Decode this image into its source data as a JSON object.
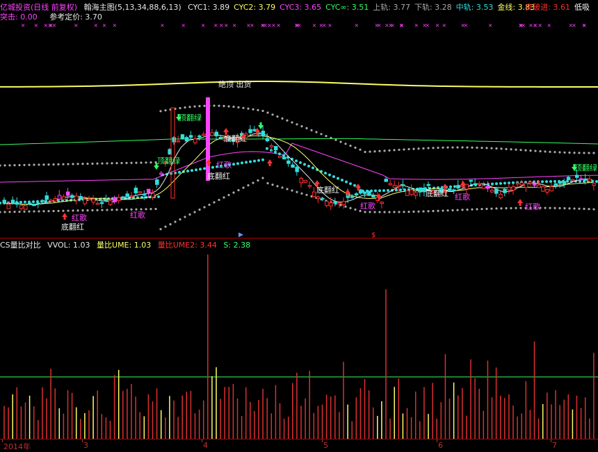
{
  "header": {
    "app_title": "亿城投资(日线 前复权)",
    "indicator_name": "翰海主图(5,13,34,88,6,13)",
    "items": [
      {
        "label": "CYC1: 3.89",
        "color": "#e8e8e8"
      },
      {
        "label": "CYC2: 3.79",
        "color": "#ffff66"
      },
      {
        "label": "CYC3: 3.65",
        "color": "#ff44ff"
      },
      {
        "label": "CYC∞: 3.51",
        "color": "#33ff66"
      },
      {
        "label": "上轨: 3.77",
        "color": "#aaaaaa"
      },
      {
        "label": "下轨: 3.28",
        "color": "#aaaaaa"
      },
      {
        "label": "中轨: 3.53",
        "color": "#33dddd"
      },
      {
        "label": "金线: 3.83",
        "color": "#ffff66"
      }
    ],
    "right_items": [
      {
        "label": "突破进: 3.61",
        "color": "#ff3030"
      },
      {
        "label": "低吸",
        "color": "#ffffff"
      }
    ]
  },
  "subheader": {
    "tuji": "突击: 0.00",
    "cankao": "参考定价: 3.70"
  },
  "annotations": {
    "juexian": "绝顶 出货",
    "dingfanlv": "顶翻绿",
    "difanhong": "底翻红",
    "hongge": "红歌"
  },
  "volume_panel": {
    "title": "CS量比对比",
    "vvol": "VVOL: 1.03",
    "ume": "量比UME: 1.03",
    "ume2": "量比UME2: 3.44",
    "s": "S: 2.38"
  },
  "xaxis": {
    "labels": [
      "2014年",
      "3",
      "4",
      "5",
      "6",
      "7"
    ]
  },
  "colors": {
    "up_candle": "#ff3030",
    "down_candle": "#33dddd",
    "gold_line": "#ffff66",
    "cyc_magenta": "#ff44ff",
    "cyc_green": "#33ff66",
    "band_dots": "#aaaaaa",
    "mid_dots": "#33dddd"
  }
}
